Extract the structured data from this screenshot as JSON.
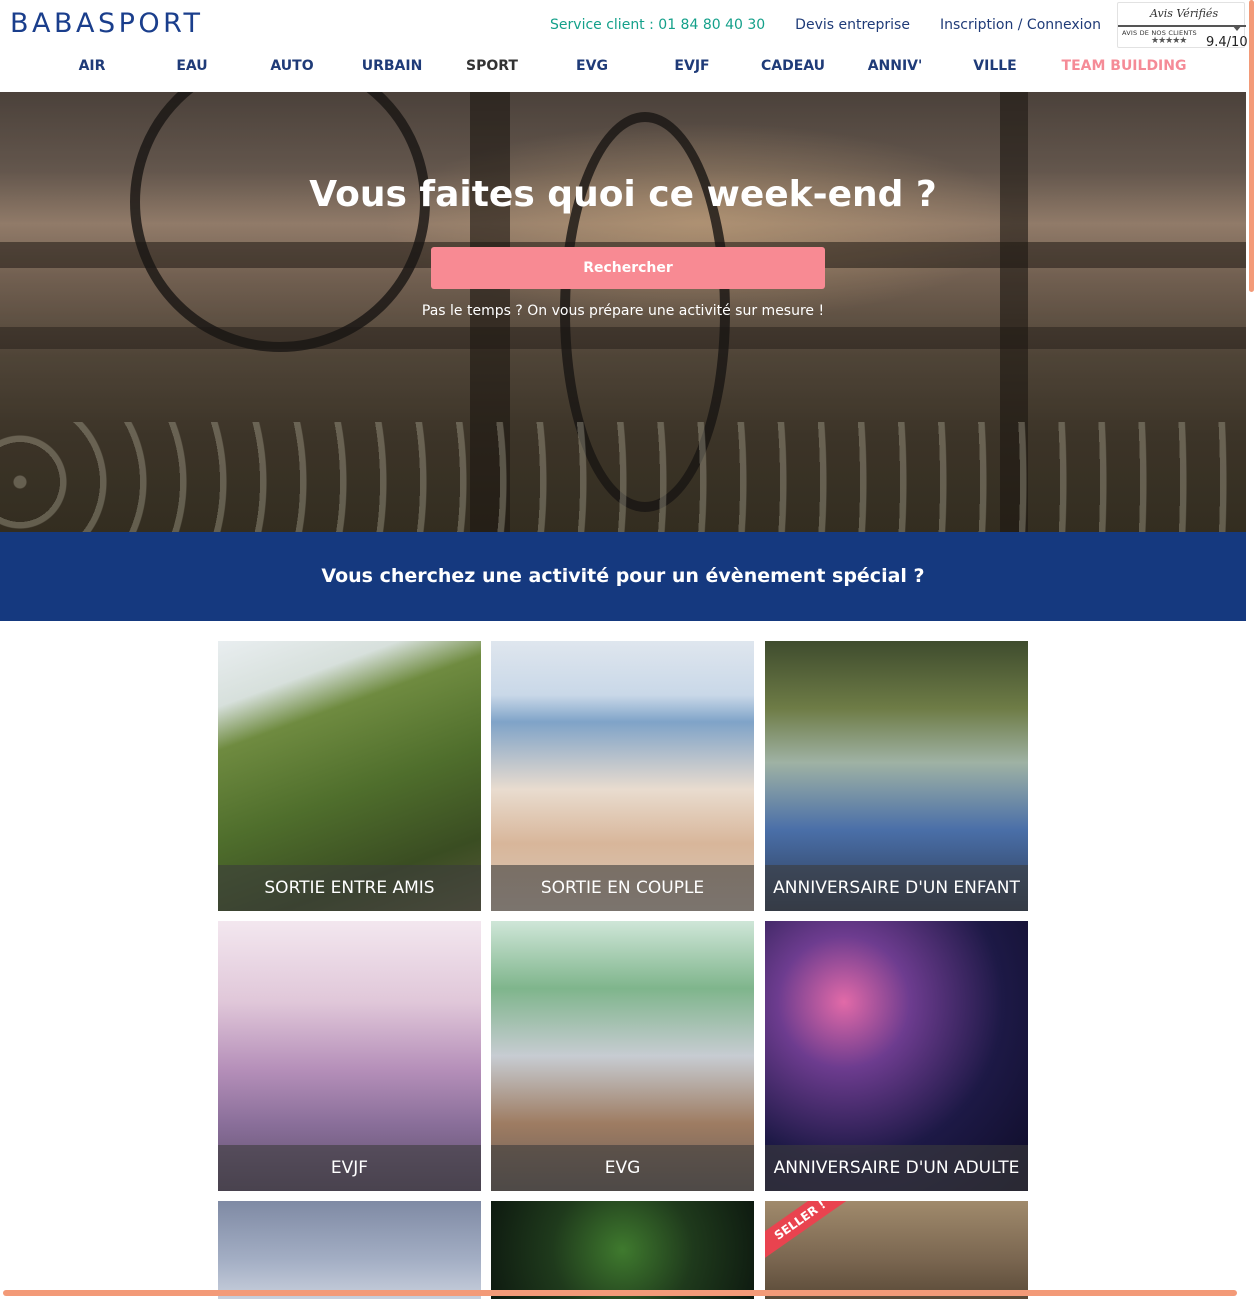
{
  "header": {
    "logo": "BABASPORT",
    "service_client": "Service client : 01 84 80 40 30",
    "devis": "Devis entreprise",
    "login": "Inscription / Connexion",
    "avis": {
      "brand": "Avis Vérifiés",
      "subtitle": "AVIS DE NOS CLIENTS",
      "stars": "★★★★★",
      "score": "9.4/10"
    }
  },
  "nav": {
    "items": [
      "AIR",
      "EAU",
      "AUTO",
      "URBAIN",
      "SPORT",
      "EVG",
      "EVJF",
      "CADEAU",
      "ANNIV'",
      "VILLE",
      "TEAM BUILDING"
    ]
  },
  "hero": {
    "title": "Vous faites quoi ce week-end ?",
    "button": "Rechercher",
    "subtitle": "Pas le temps ? On vous prépare une activité sur mesure !"
  },
  "banner": {
    "title": "Vous cherchez une activité pour un évènement spécial ?"
  },
  "tiles": [
    {
      "caption": "SORTIE ENTRE AMIS"
    },
    {
      "caption": "SORTIE EN COUPLE"
    },
    {
      "caption": "ANNIVERSAIRE D'UN ENFANT"
    },
    {
      "caption": "EVJF"
    },
    {
      "caption": "EVG"
    },
    {
      "caption": "ANNIVERSAIRE D'UN ADULTE"
    },
    {
      "caption": ""
    },
    {
      "caption": ""
    },
    {
      "caption": "",
      "ribbon": "SELLER !"
    }
  ],
  "colors": {
    "brand_blue": "#1a3e8c",
    "service_green": "#14a08a",
    "button_pink": "#f88a93",
    "banner_blue": "#15397f",
    "team_pink": "#f58b97"
  }
}
